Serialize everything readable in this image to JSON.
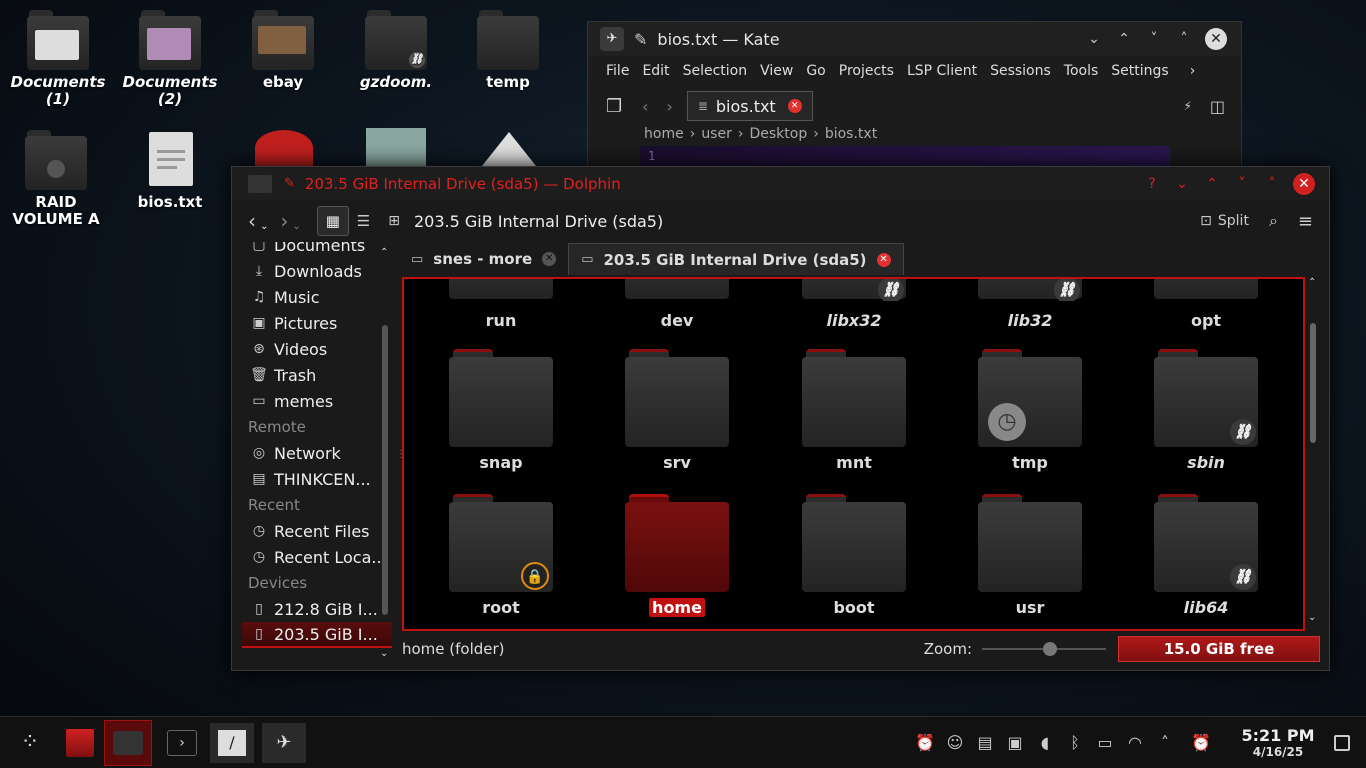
{
  "desktop": {
    "icons": [
      {
        "label1": "Documents",
        "label2": "(1)",
        "italic": true
      },
      {
        "label1": "Documents",
        "label2": "(2)",
        "italic": true
      },
      {
        "label1": "ebay",
        "label2": "",
        "italic": false
      },
      {
        "label1": "gzdoom.",
        "label2": "",
        "italic": true
      },
      {
        "label1": "temp",
        "label2": "",
        "italic": false
      },
      {
        "label1": "RAID",
        "label2": "VOLUME A",
        "italic": false
      },
      {
        "label1": "bios.txt",
        "label2": "",
        "italic": false
      }
    ]
  },
  "kate": {
    "title": "bios.txt — Kate",
    "menu": [
      "File",
      "Edit",
      "Selection",
      "View",
      "Go",
      "Projects",
      "LSP Client",
      "Sessions",
      "Tools",
      "Settings"
    ],
    "tab": "bios.txt",
    "breadcrumb": [
      "home",
      "user",
      "Desktop",
      "bios.txt"
    ],
    "line_number": "1"
  },
  "dolphin": {
    "title": "203.5 GiB Internal Drive (sda5) — Dolphin",
    "location": "203.5 GiB Internal Drive (sda5)",
    "split_label": "Split",
    "sidebar": {
      "places": [
        "Documents",
        "Downloads",
        "Music",
        "Pictures",
        "Videos",
        "Trash",
        "memes"
      ],
      "remote_header": "Remote",
      "remote": [
        "Network",
        "THINKCEN..."
      ],
      "recent_header": "Recent",
      "recent": [
        "Recent Files",
        "Recent Loca..."
      ],
      "devices_header": "Devices",
      "devices": [
        "212.8 GiB I...",
        "203.5 GiB I..."
      ]
    },
    "tabs": [
      "snes - more",
      "203.5 GiB Internal Drive (sda5)"
    ],
    "folders_row1": [
      "run",
      "dev",
      "libx32",
      "lib32",
      "opt"
    ],
    "folders_row2": [
      "snap",
      "srv",
      "mnt",
      "tmp",
      "sbin"
    ],
    "folders_row3": [
      "root",
      "home",
      "boot",
      "usr",
      "lib64"
    ],
    "status_text": "home (folder)",
    "zoom_label": "Zoom:",
    "zoom_level": 0.55,
    "free_space": "15.0 GiB free"
  },
  "taskbar": {
    "time": "5:21 PM",
    "date": "4/16/25"
  },
  "colors": {
    "accent": "#c01010",
    "bg": "#0d1620"
  }
}
